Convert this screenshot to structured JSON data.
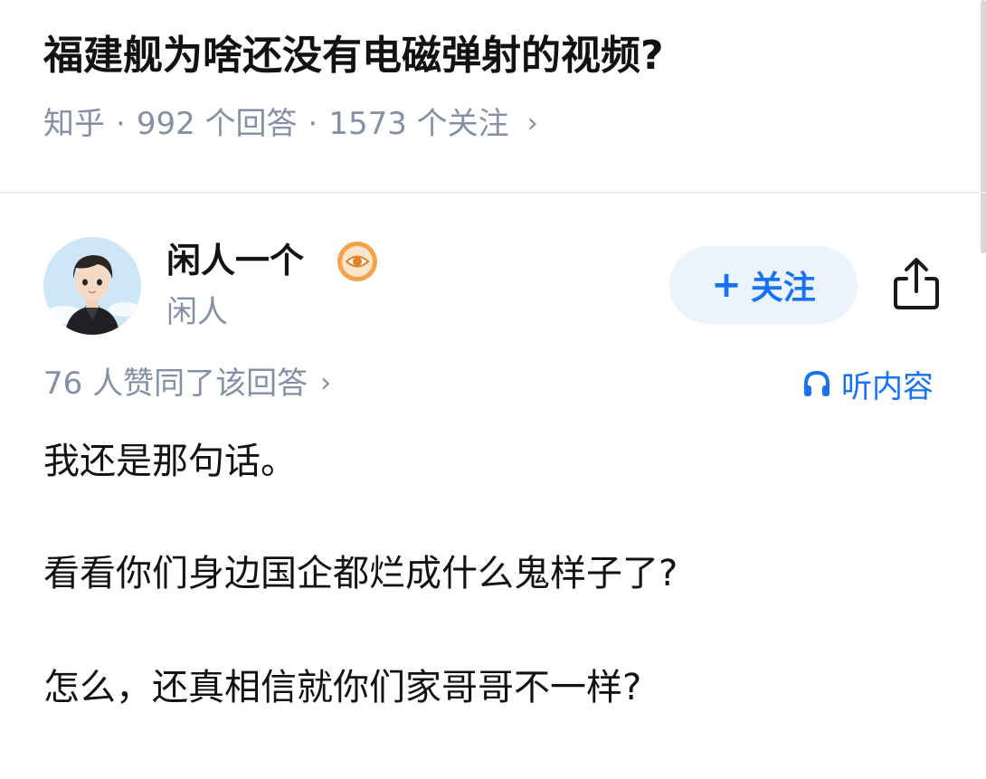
{
  "question": {
    "title": "福建舰为啥还没有电磁弹射的视频?",
    "source": "知乎",
    "answer_count": "992 个回答",
    "follow_count": "1573 个关注",
    "separator": "·"
  },
  "author": {
    "name": "闲人一个",
    "bio": "闲人",
    "badge_icon": "eye-icon"
  },
  "actions": {
    "follow_label": "关注",
    "follow_plus": "+",
    "share_icon": "share-icon"
  },
  "answer": {
    "votes": "76 人赞同了该回答",
    "listen_label": "听内容",
    "paragraphs": [
      "我还是那句话。",
      "看看你们身边国企都烂成什么鬼样子了?",
      "怎么，还真相信就你们家哥哥不一样?"
    ]
  },
  "colors": {
    "accent": "#1772f6",
    "follow_bg": "#ebf3fd",
    "meta_gray": "#8590a6",
    "badge_orange": "#f29a3d"
  }
}
